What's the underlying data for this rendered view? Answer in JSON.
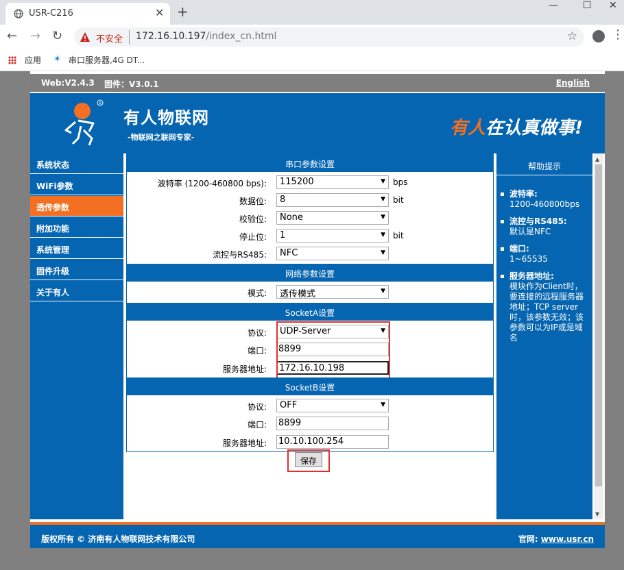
{
  "browser": {
    "tab_title": "USR-C216",
    "tab_close": "✕",
    "new_tab": "+",
    "window_controls": {
      "minimize": "—",
      "maximize": "☐",
      "close": "✕"
    },
    "not_secure": "不安全",
    "url_host": "172.16.10.197",
    "url_path": "/index_cn.html",
    "bookmarks": {
      "apps": "应用",
      "item1": "串口服务器,4G DT..."
    }
  },
  "page": {
    "topbar": {
      "web_version": "Web:V2.4.3",
      "firmware_version": "固件：V3.0.1",
      "language_link": "English"
    },
    "banner": {
      "brand_name": "有人物联网",
      "slogan": "-物联网之联网专家-",
      "motto_part1": "有人",
      "motto_part2": "在认真做事!"
    },
    "sidebar": [
      {
        "label": "系统状态",
        "active": false
      },
      {
        "label": "WiFi参数",
        "active": false
      },
      {
        "label": "透传参数",
        "active": true
      },
      {
        "label": "附加功能",
        "active": false
      },
      {
        "label": "系统管理",
        "active": false
      },
      {
        "label": "固件升级",
        "active": false
      },
      {
        "label": "关于有人",
        "active": false
      }
    ],
    "serial": {
      "title": "串口参数设置",
      "baud_label": "波特率 (1200-460800 bps):",
      "baud_value": "115200",
      "baud_unit": "bps",
      "databits_label": "数据位:",
      "databits_value": "8",
      "databits_unit": "bit",
      "parity_label": "校验位:",
      "parity_value": "None",
      "stopbits_label": "停止位:",
      "stopbits_value": "1",
      "stopbits_unit": "bit",
      "flow_label": "流控与RS485:",
      "flow_value": "NFC"
    },
    "network": {
      "title": "网络参数设置",
      "mode_label": "模式:",
      "mode_value": "透传模式"
    },
    "socketA": {
      "title": "SocketA设置",
      "protocol_label": "协议:",
      "protocol_value": "UDP-Server",
      "port_label": "端口:",
      "port_value": "8899",
      "server_label": "服务器地址:",
      "server_value": "172.16.10.198"
    },
    "socketB": {
      "title": "SocketB设置",
      "protocol_label": "协议:",
      "protocol_value": "OFF",
      "port_label": "端口:",
      "port_value": "8899",
      "server_label": "服务器地址:",
      "server_value": "10.10.100.254"
    },
    "save_label": "保存",
    "help": {
      "title": "帮助提示",
      "items": [
        {
          "title": "波特率:",
          "text": "1200-460800bps"
        },
        {
          "title": "流控与RS485:",
          "text": "默认是NFC"
        },
        {
          "title": "端口:",
          "text": "1~65535"
        },
        {
          "title": "服务器地址:",
          "text": "模块作为Client时，要连接的远程服务器地址；TCP server时，该参数无效；该参数可以为IP或是域名"
        }
      ]
    },
    "footer": {
      "copyright": "版权所有 © 济南有人物联网技术有限公司",
      "site_label": "官网:",
      "site_url": "www.usr.cn"
    }
  },
  "colors": {
    "brand_blue": "#0565b0",
    "brand_orange": "#f36f21",
    "highlight_red": "#e03030"
  }
}
